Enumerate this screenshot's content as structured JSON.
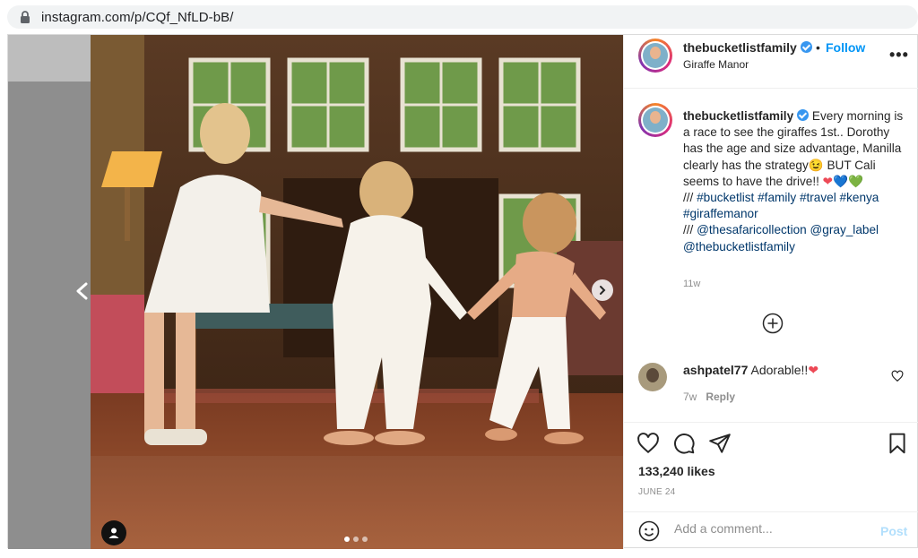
{
  "browser": {
    "url": "instagram.com/p/CQf_NfLD-bB/"
  },
  "media": {
    "total_slides": 3,
    "active_slide": 1
  },
  "header": {
    "username": "thebucketlistfamily",
    "dot": "•",
    "follow_label": "Follow",
    "location": "Giraffe Manor",
    "more_label": "•••"
  },
  "caption": {
    "username": "thebucketlistfamily",
    "text_1": "Every morning is a race to see the giraffes 1st.. Dorothy has the age and size advantage, Manilla clearly has the strategy",
    "emoji_1": "😉",
    "text_2": " BUT Cali seems to have the drive!! ",
    "hearts": "❤💙💚",
    "tags_prefix": "/// ",
    "tags": "#bucketlist #family #travel #kenya #giraffemanor",
    "mentions_prefix": "/// ",
    "mentions": "@thesafaricollection @gray_label @thebucketlistfamily",
    "time": "11w"
  },
  "comment": {
    "username": "ashpatel77",
    "text": "Adorable!!",
    "heart": "❤",
    "time": "7w",
    "reply_label": "Reply"
  },
  "actions": {
    "likes": "133,240 likes",
    "date": "JUNE 24"
  },
  "comment_input": {
    "placeholder": "Add a comment...",
    "post_label": "Post"
  },
  "colors": {
    "link_blue": "#0095f6",
    "tag_blue": "#00376b",
    "heart_red": "#ed4956",
    "muted": "#8e8e8e"
  }
}
